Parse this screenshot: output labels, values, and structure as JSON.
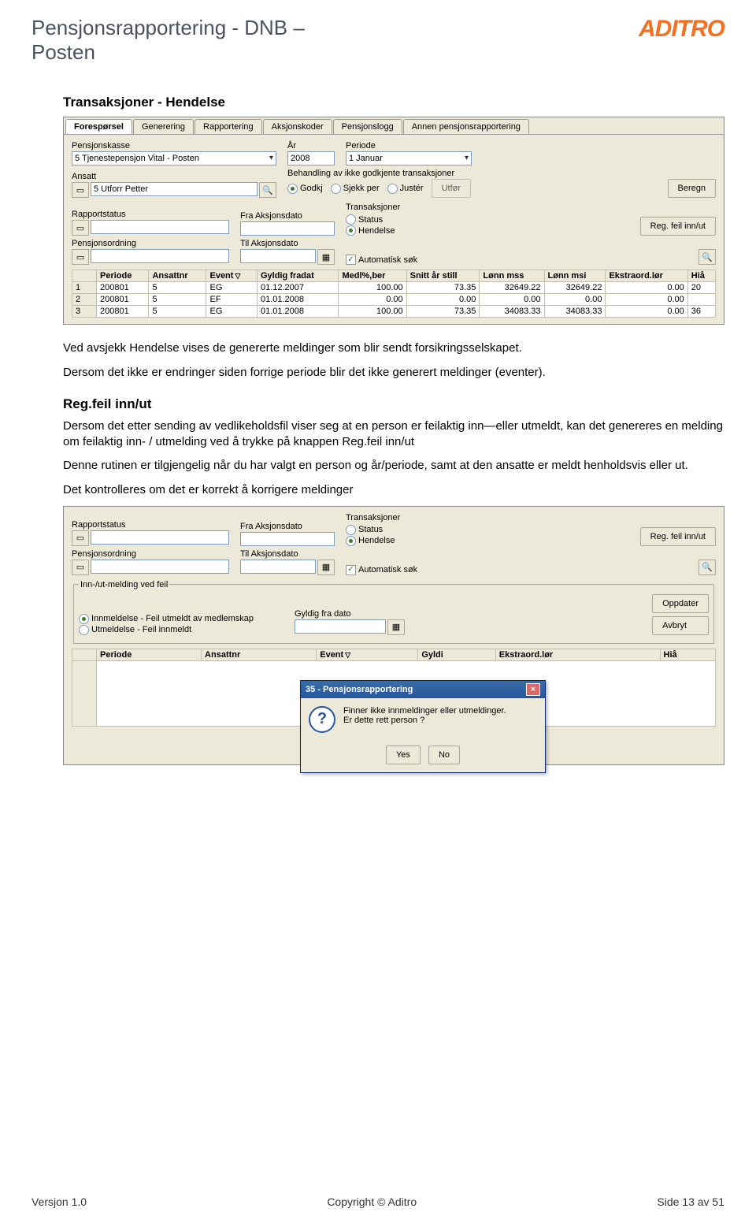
{
  "header": {
    "title_line1": "Pensjonsrapportering - DNB –",
    "title_line2": "Posten",
    "logo": "ADITRO"
  },
  "section": {
    "heading": "Transaksjoner - Hendelse",
    "p1": "Ved avsjekk Hendelse vises de genererte meldinger som blir sendt forsikringsselskapet.",
    "p2": "Dersom det ikke er endringer siden forrige periode blir det ikke generert meldinger (eventer).",
    "sub_heading": "Reg.feil inn/ut",
    "p3": "Dersom det etter sending av vedlikeholdsfil viser seg at en person er feilaktig inn—eller utmeldt, kan det genereres en melding om feilaktig inn- / utmelding ved å trykke på knappen Reg.feil inn/ut",
    "p4": "Denne rutinen er tilgjengelig når du har valgt en person og år/periode, samt at den ansatte er meldt henholdsvis eller ut.",
    "p5": "Det kontrolleres om det er korrekt å korrigere meldinger"
  },
  "win1": {
    "tabs": [
      "Forespørsel",
      "Generering",
      "Rapportering",
      "Aksjonskoder",
      "Pensjonslogg",
      "Annen pensjonsrapportering"
    ],
    "active_tab": 0,
    "labels": {
      "pensjonskasse": "Pensjonskasse",
      "ar": "År",
      "periode": "Periode",
      "ansatt": "Ansatt",
      "behandling": "Behandling av ikke godkjente transaksjoner",
      "rapportstatus": "Rapportstatus",
      "fra_aksjon": "Fra Aksjonsdato",
      "pensjonsordning": "Pensjonsordning",
      "til_aksjon": "Til Aksjonsdato",
      "transaksjoner": "Transaksjoner",
      "autosok": "Automatisk søk"
    },
    "values": {
      "pensjonskasse": "5 Tjenestepensjon Vital - Posten",
      "ar": "2008",
      "periode": "1 Januar",
      "ansatt": "5 Utforr Petter"
    },
    "radios": {
      "godkj": "Godkj",
      "sjekk": "Sjekk per",
      "juster": "Justér",
      "status": "Status",
      "hendelse": "Hendelse"
    },
    "buttons": {
      "utfor": "Utfør",
      "beregn": "Beregn",
      "regfeil": "Reg. feil inn/ut"
    },
    "grid": {
      "headers": [
        "",
        "Periode",
        "Ansattnr",
        "Event",
        "Gyldig fradat",
        "Medl%,ber",
        "Snitt år still",
        "Lønn mss",
        "Lønn msi",
        "Ekstraord.lør",
        "Hiå"
      ],
      "rows": [
        [
          "1",
          "200801",
          "5",
          "EG",
          "01.12.2007",
          "100.00",
          "73.35",
          "32649.22",
          "32649.22",
          "0.00",
          "20"
        ],
        [
          "2",
          "200801",
          "5",
          "EF",
          "01.01.2008",
          "0.00",
          "0.00",
          "0.00",
          "0.00",
          "0.00",
          ""
        ],
        [
          "3",
          "200801",
          "5",
          "EG",
          "01.01.2008",
          "100.00",
          "73.35",
          "34083.33",
          "34083.33",
          "0.00",
          "36"
        ]
      ]
    }
  },
  "win2": {
    "labels": {
      "rapportstatus": "Rapportstatus",
      "fra_aksjon": "Fra Aksjonsdato",
      "pensjonsordning": "Pensjonsordning",
      "til_aksjon": "Til Aksjonsdato",
      "transaksjoner": "Transaksjoner",
      "autosok": "Automatisk søk",
      "group": "Inn-/ut-melding ved feil",
      "opt1": "Innmeldelse - Feil utmeldt av medlemskap",
      "opt2": "Utmeldelse - Feil innmeldt",
      "gyldig": "Gyldig fra dato"
    },
    "radios": {
      "status": "Status",
      "hendelse": "Hendelse"
    },
    "buttons": {
      "regfeil": "Reg. feil inn/ut",
      "oppdater": "Oppdater",
      "avbryt": "Avbryt"
    },
    "grid": {
      "headers": [
        "",
        "Periode",
        "Ansattnr",
        "Event",
        "Gyldi",
        "Ekstraord.lør",
        "Hiå"
      ]
    },
    "dialog": {
      "title": "35 - Pensjonsrapportering",
      "msg1": "Finner ikke innmeldinger eller utmeldinger.",
      "msg2": "Er dette rett person ?",
      "yes": "Yes",
      "no": "No",
      "close": "×"
    }
  },
  "footer": {
    "left": "Versjon 1.0",
    "center": "Copyright © Aditro",
    "right": "Side 13 av 51"
  }
}
